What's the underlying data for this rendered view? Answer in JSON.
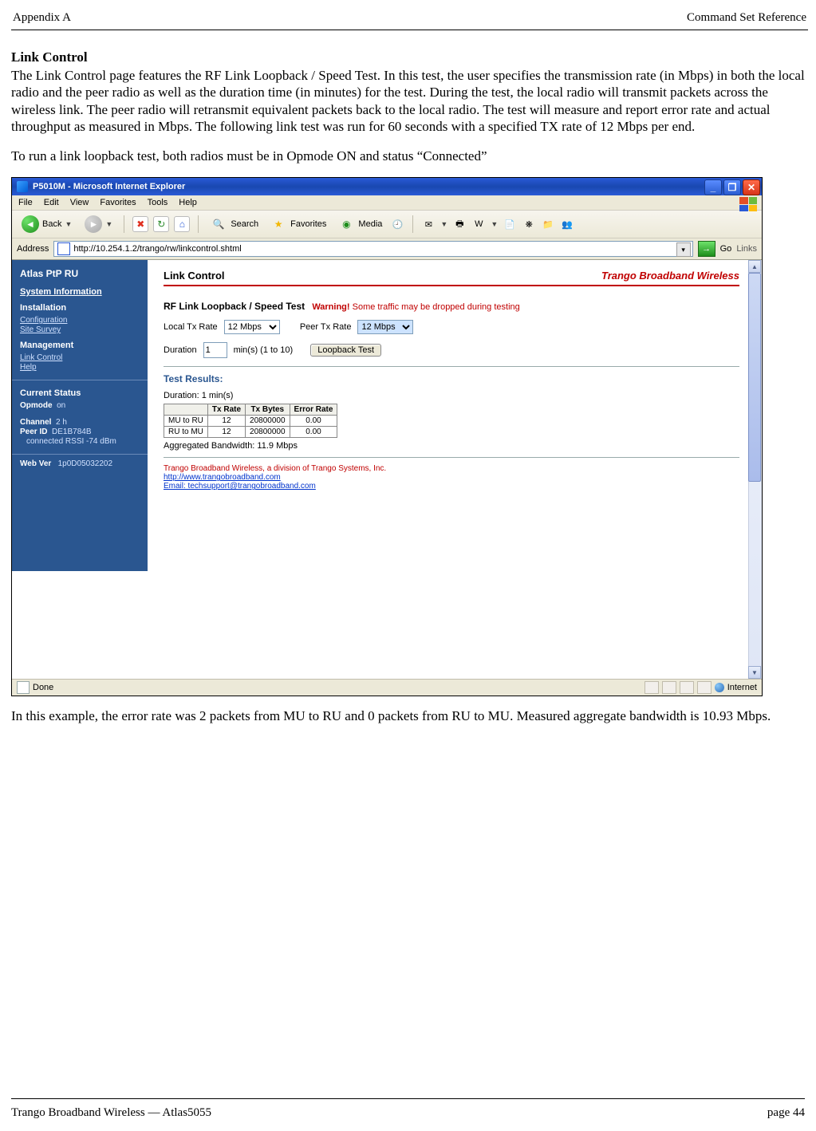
{
  "doc": {
    "header_left": "Appendix A",
    "header_right": "Command Set Reference",
    "section_title": "Link Control",
    "para1": "The Link Control page features the RF Link Loopback / Speed Test.  In this test, the user specifies the transmission rate (in Mbps) in both the local radio and the peer radio as well as the duration time (in minutes) for the test.   During the test, the local radio will transmit packets across the wireless link.  The peer radio will retransmit equivalent packets back to the local radio.  The test will measure and report error rate and actual throughput as measured in Mbps.  The following link test was run for 60 seconds with a specified TX rate of 12 Mbps per end.",
    "para2": "To run a link loopback test, both radios must be in Opmode ON and status “Connected”",
    "para3": "In this example, the error rate was 2 packets from MU to RU and 0 packets from RU to MU.  Measured aggregate bandwidth is 10.93 Mbps.",
    "footer_left": "Trango Broadband Wireless — Atlas5055",
    "footer_right": "page 44"
  },
  "ie": {
    "title": "P5010M - Microsoft Internet Explorer",
    "menu": [
      "File",
      "Edit",
      "View",
      "Favorites",
      "Tools",
      "Help"
    ],
    "toolbar": {
      "back": "Back",
      "search": "Search",
      "favorites": "Favorites",
      "media": "Media"
    },
    "address_label": "Address",
    "url": "http://10.254.1.2/trango/rw/linkcontrol.shtml",
    "go": "Go",
    "links": "Links",
    "status_done": "Done",
    "status_zone": "Internet"
  },
  "sidebar": {
    "title": "Atlas PtP RU",
    "sysinfo": "System Information",
    "install": "Installation",
    "install_links": [
      "Configuration",
      "Site Survey"
    ],
    "mgmt": "Management",
    "mgmt_links": [
      "Link Control",
      "Help"
    ],
    "cs_title": "Current Status",
    "opmode_label": "Opmode",
    "opmode_value": "on",
    "channel_label": "Channel",
    "channel_value": "2 h",
    "peerid_label": "Peer ID",
    "peerid_value": "DE1B784B",
    "conn_line": "connected RSSI -74 dBm",
    "webver_label": "Web Ver",
    "webver_value": "1p0D05032202"
  },
  "main": {
    "page_title": "Link Control",
    "brand": "Trango Broadband Wireless",
    "test_title": "RF Link Loopback / Speed Test",
    "warn_label": "Warning!",
    "warn_text": " Some traffic may be dropped during testing",
    "local_tx_label": "Local Tx Rate",
    "local_tx_value": "12 Mbps",
    "peer_tx_label": "Peer Tx Rate",
    "peer_tx_value": "12 Mbps",
    "duration_label": "Duration",
    "duration_value": "1",
    "duration_unit": "min(s)   (1 to 10)",
    "btn_label": "Loopback Test",
    "results_title": "Test Results:",
    "duration_line": "Duration: 1 min(s)",
    "table": {
      "headers": [
        "",
        "Tx Rate",
        "Tx Bytes",
        "Error Rate"
      ],
      "rows": [
        [
          "MU to RU",
          "12",
          "20800000",
          "0.00"
        ],
        [
          "RU to MU",
          "12",
          "20800000",
          "0.00"
        ]
      ]
    },
    "agg_line": "Aggregated Bandwidth: 11.9 Mbps",
    "footer_company": "Trango Broadband Wireless, a division of Trango Systems, Inc.",
    "footer_url": "http://www.trangobroadband.com",
    "footer_email": "Email: techsupport@trangobroadband.com"
  }
}
